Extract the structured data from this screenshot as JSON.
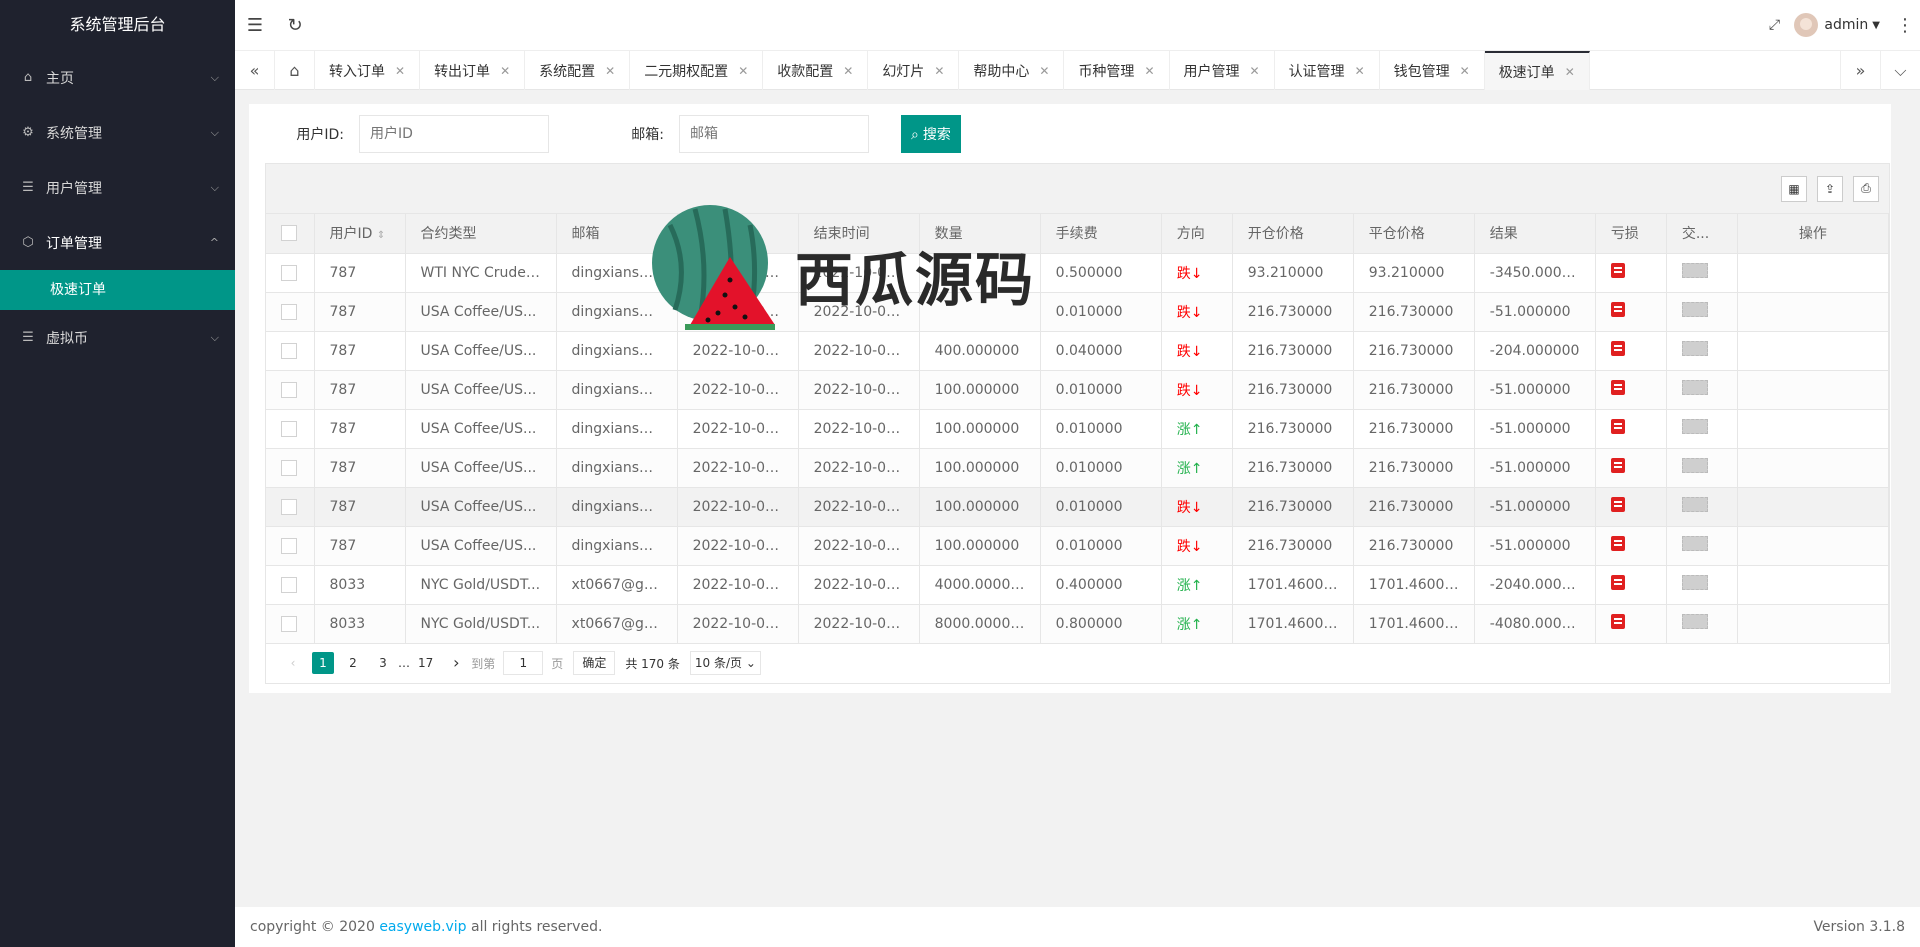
{
  "sidebar": {
    "logo": "系统管理后台",
    "items": [
      {
        "label": "主页",
        "icon": "home-icon",
        "chev": "⌄"
      },
      {
        "label": "系统管理",
        "icon": "gear-icon",
        "chev": "⌄"
      },
      {
        "label": "用户管理",
        "icon": "list-icon",
        "chev": "⌄"
      },
      {
        "label": "订单管理",
        "icon": "cube-icon",
        "chev": "⌃"
      },
      {
        "label": "虚拟币",
        "icon": "list-icon",
        "chev": "⌄"
      }
    ],
    "active_sub": "极速订单"
  },
  "header": {
    "user": "admin"
  },
  "tabs": [
    {
      "label": "转入订单"
    },
    {
      "label": "转出订单"
    },
    {
      "label": "系统配置"
    },
    {
      "label": "二元期权配置"
    },
    {
      "label": "收款配置"
    },
    {
      "label": "幻灯片"
    },
    {
      "label": "帮助中心"
    },
    {
      "label": "币种管理"
    },
    {
      "label": "用户管理"
    },
    {
      "label": "认证管理"
    },
    {
      "label": "钱包管理"
    },
    {
      "label": "极速订单"
    }
  ],
  "search": {
    "user_id_label": "用户ID:",
    "user_id_placeholder": "用户ID",
    "email_label": "邮箱:",
    "email_placeholder": "邮箱",
    "button": "搜索"
  },
  "table": {
    "columns": [
      "用户ID",
      "合约类型",
      "邮箱",
      "开始时间",
      "结束时间",
      "数量",
      "手续费",
      "方向",
      "开仓价格",
      "平仓价格",
      "结果",
      "亏损",
      "交...",
      "操作"
    ],
    "rows": [
      {
        "uid": "787",
        "type": "WTI NYC Crude ...",
        "email": "dingxiansen...",
        "start": "2022-10-08 ...",
        "end": "2022-10-08 ...",
        "qty": "",
        "fee": "0.500000",
        "dir": "跌↓",
        "dir_kind": "down",
        "open": "93.210000",
        "close": "93.210000",
        "result": "-3450.000000"
      },
      {
        "uid": "787",
        "type": "USA Coffee/US...",
        "email": "dingxiansen...",
        "start": "2022-10-08 ...",
        "end": "2022-10-08 ...",
        "qty": "",
        "fee": "0.010000",
        "dir": "跌↓",
        "dir_kind": "down",
        "open": "216.730000",
        "close": "216.730000",
        "result": "-51.000000"
      },
      {
        "uid": "787",
        "type": "USA Coffee/US...",
        "email": "dingxiansen...",
        "start": "2022-10-08 ...",
        "end": "2022-10-08 ...",
        "qty": "400.000000",
        "fee": "0.040000",
        "dir": "跌↓",
        "dir_kind": "down",
        "open": "216.730000",
        "close": "216.730000",
        "result": "-204.000000"
      },
      {
        "uid": "787",
        "type": "USA Coffee/US...",
        "email": "dingxiansen...",
        "start": "2022-10-08 ...",
        "end": "2022-10-08 ...",
        "qty": "100.000000",
        "fee": "0.010000",
        "dir": "跌↓",
        "dir_kind": "down",
        "open": "216.730000",
        "close": "216.730000",
        "result": "-51.000000"
      },
      {
        "uid": "787",
        "type": "USA Coffee/US...",
        "email": "dingxiansen...",
        "start": "2022-10-08 ...",
        "end": "2022-10-08 ...",
        "qty": "100.000000",
        "fee": "0.010000",
        "dir": "涨↑",
        "dir_kind": "up",
        "open": "216.730000",
        "close": "216.730000",
        "result": "-51.000000"
      },
      {
        "uid": "787",
        "type": "USA Coffee/US...",
        "email": "dingxiansen...",
        "start": "2022-10-08 ...",
        "end": "2022-10-08 ...",
        "qty": "100.000000",
        "fee": "0.010000",
        "dir": "涨↑",
        "dir_kind": "up",
        "open": "216.730000",
        "close": "216.730000",
        "result": "-51.000000"
      },
      {
        "uid": "787",
        "type": "USA Coffee/US...",
        "email": "dingxiansen...",
        "start": "2022-10-08 ...",
        "end": "2022-10-08 ...",
        "qty": "100.000000",
        "fee": "0.010000",
        "dir": "跌↓",
        "dir_kind": "down",
        "open": "216.730000",
        "close": "216.730000",
        "result": "-51.000000"
      },
      {
        "uid": "787",
        "type": "USA Coffee/US...",
        "email": "dingxiansen...",
        "start": "2022-10-08 ...",
        "end": "2022-10-08 ...",
        "qty": "100.000000",
        "fee": "0.010000",
        "dir": "跌↓",
        "dir_kind": "down",
        "open": "216.730000",
        "close": "216.730000",
        "result": "-51.000000"
      },
      {
        "uid": "8033",
        "type": "NYC Gold/USDT...",
        "email": "xt0667@gm...",
        "start": "2022-10-08 ...",
        "end": "2022-10-08 ...",
        "qty": "4000.000000",
        "fee": "0.400000",
        "dir": "涨↑",
        "dir_kind": "up",
        "open": "1701.460000",
        "close": "1701.460000",
        "result": "-2040.000000"
      },
      {
        "uid": "8033",
        "type": "NYC Gold/USDT...",
        "email": "xt0667@gm...",
        "start": "2022-10-08 ...",
        "end": "2022-10-08 ...",
        "qty": "8000.000000",
        "fee": "0.800000",
        "dir": "涨↑",
        "dir_kind": "up",
        "open": "1701.460000",
        "close": "1701.460000",
        "result": "-4080.000000"
      }
    ]
  },
  "pager": {
    "pages": [
      "1",
      "2",
      "3",
      "…",
      "17"
    ],
    "goto": "到第",
    "page_value": "1",
    "page_unit": "页",
    "confirm": "确定",
    "total": "共 170 条",
    "per_page": "10 条/页"
  },
  "footer": {
    "prefix": "copyright © 2020 ",
    "link": "easyweb.vip",
    "suffix": " all rights reserved.",
    "version": "Version 3.1.8"
  },
  "watermark": "西瓜源码",
  "colors": {
    "sidebar_bg": "#1f222e",
    "accent": "#009688",
    "down": "#ff0000",
    "up": "#22b14c"
  }
}
